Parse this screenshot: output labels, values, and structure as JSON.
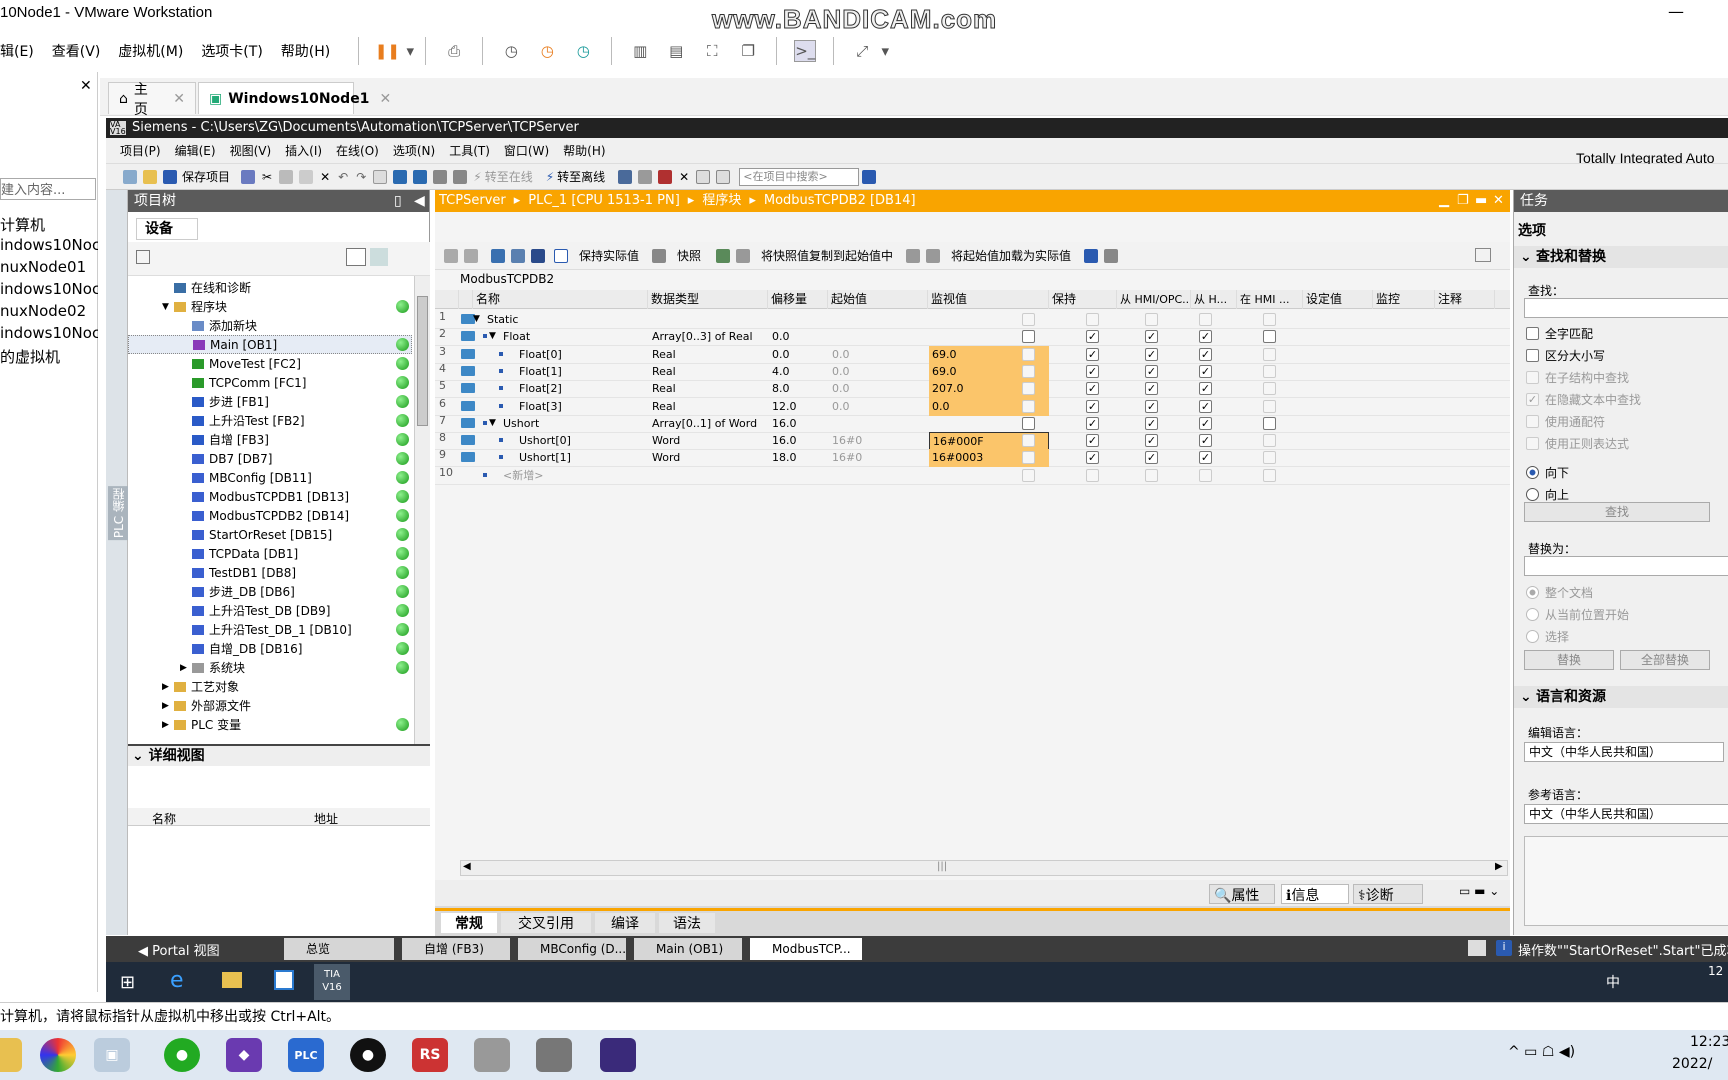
{
  "vm": {
    "title": "10Node1 - VMware Workstation",
    "watermark": "www.BANDICAM.com",
    "menu": [
      "辑(E)",
      "查看(V)",
      "虚拟机(M)",
      "选项卡(T)",
      "帮助(H)"
    ],
    "library": {
      "search_placeholder": "建入内容...",
      "items": [
        "计算机",
        "indows10Noc",
        "nuxNode01",
        "indows10Noc",
        "nuxNode02",
        "indows10Noc",
        "的虚拟机"
      ]
    },
    "tabs": [
      {
        "label": "主页"
      },
      {
        "label": "Windows10Node1"
      }
    ],
    "status": "计算机，请将鼠标指针从虚拟机中移出或按 Ctrl+Alt。"
  },
  "tia": {
    "title": "Siemens  -  C:\\Users\\ZG\\Documents\\Automation\\TCPServer\\TCPServer",
    "title_logo": "VA V16",
    "brand": "Totally Integrated Auto",
    "menu": [
      "项目(P)",
      "编辑(E)",
      "视图(V)",
      "插入(I)",
      "在线(O)",
      "选项(N)",
      "工具(T)",
      "窗口(W)",
      "帮助(H)"
    ],
    "toolbar": {
      "save": "保存项目",
      "go_online": "转至在线",
      "go_offline": "转至离线",
      "search_placeholder": "<在项目中搜索>"
    },
    "project_tree": {
      "title": "项目树",
      "tab": "设备",
      "side_label": "PLC 编程",
      "items": [
        {
          "label": "在线和诊断",
          "indent": 1,
          "color": "#3a6ea5",
          "status": false,
          "expander": ""
        },
        {
          "label": "程序块",
          "indent": 1,
          "color": "#e0b040",
          "status": true,
          "expander": "▼"
        },
        {
          "label": "添加新块",
          "indent": 2,
          "color": "#6a8cc7",
          "status": false,
          "expander": ""
        },
        {
          "label": "Main [OB1]",
          "indent": 2,
          "color": "#8a3ab9",
          "status": true,
          "expander": "",
          "selected": true
        },
        {
          "label": "MoveTest [FC2]",
          "indent": 2,
          "color": "#2a9a2a",
          "status": true,
          "expander": ""
        },
        {
          "label": "TCPComm [FC1]",
          "indent": 2,
          "color": "#2a9a2a",
          "status": true,
          "expander": ""
        },
        {
          "label": "步进 [FB1]",
          "indent": 2,
          "color": "#2a5ac7",
          "status": true,
          "expander": ""
        },
        {
          "label": "上升沿Test [FB2]",
          "indent": 2,
          "color": "#2a5ac7",
          "status": true,
          "expander": ""
        },
        {
          "label": "自增 [FB3]",
          "indent": 2,
          "color": "#2a5ac7",
          "status": true,
          "expander": ""
        },
        {
          "label": "DB7 [DB7]",
          "indent": 2,
          "color": "#3a5fd0",
          "status": true,
          "expander": ""
        },
        {
          "label": "MBConfig [DB11]",
          "indent": 2,
          "color": "#3a5fd0",
          "status": true,
          "expander": ""
        },
        {
          "label": "ModbusTCPDB1 [DB13]",
          "indent": 2,
          "color": "#3a5fd0",
          "status": true,
          "expander": ""
        },
        {
          "label": "ModbusTCPDB2 [DB14]",
          "indent": 2,
          "color": "#3a5fd0",
          "status": true,
          "expander": ""
        },
        {
          "label": "StartOrReset [DB15]",
          "indent": 2,
          "color": "#3a5fd0",
          "status": true,
          "expander": ""
        },
        {
          "label": "TCPData [DB1]",
          "indent": 2,
          "color": "#3a5fd0",
          "status": true,
          "expander": ""
        },
        {
          "label": "TestDB1 [DB8]",
          "indent": 2,
          "color": "#3a5fd0",
          "status": true,
          "expander": ""
        },
        {
          "label": "步进_DB [DB6]",
          "indent": 2,
          "color": "#3a5fd0",
          "status": true,
          "expander": ""
        },
        {
          "label": "上升沿Test_DB [DB9]",
          "indent": 2,
          "color": "#3a5fd0",
          "status": true,
          "expander": ""
        },
        {
          "label": "上升沿Test_DB_1 [DB10]",
          "indent": 2,
          "color": "#3a5fd0",
          "status": true,
          "expander": ""
        },
        {
          "label": "自增_DB [DB16]",
          "indent": 2,
          "color": "#3a5fd0",
          "status": true,
          "expander": ""
        },
        {
          "label": "系统块",
          "indent": 2,
          "color": "#999",
          "status": true,
          "expander": "▶"
        },
        {
          "label": "工艺对象",
          "indent": 1,
          "color": "#e0b040",
          "status": false,
          "expander": "▶"
        },
        {
          "label": "外部源文件",
          "indent": 1,
          "color": "#e0b040",
          "status": false,
          "expander": "▶"
        },
        {
          "label": "PLC 变量",
          "indent": 1,
          "color": "#e0b040",
          "status": true,
          "expander": "▶"
        }
      ]
    },
    "detail_view": {
      "title": "详细视图",
      "col_name": "名称",
      "col_address": "地址"
    },
    "breadcrumb": [
      "TCPServer",
      "PLC_1 [CPU 1513-1 PN]",
      "程序块",
      "ModbusTCPDB2 [DB14]"
    ],
    "editor_toolbar": {
      "keep_actual": "保持实际值",
      "snapshot": "快照",
      "copy_snapshot": "将快照值复制到起始值中",
      "load_start": "将起始值加载为实际值"
    },
    "db_name": "ModbusTCPDB2",
    "columns": [
      "名称",
      "数据类型",
      "偏移量",
      "起始值",
      "监视值",
      "保持",
      "从 HMI/OPC...",
      "从 H...",
      "在 HMI ...",
      "设定值",
      "监控",
      "注释"
    ],
    "rows": [
      {
        "n": "1",
        "level": 0,
        "exp": "▼",
        "name": "Static",
        "type": "",
        "off": "",
        "start": "",
        "mon": "",
        "chk": [
          0,
          0,
          0,
          0
        ],
        "dis": true
      },
      {
        "n": "2",
        "level": 1,
        "exp": "▼",
        "name": "Float",
        "type": "Array[0..3] of Real",
        "off": "0.0",
        "start": "",
        "mon": "",
        "chk": [
          0,
          1,
          1,
          1
        ],
        "dis": false
      },
      {
        "n": "3",
        "level": 2,
        "exp": "",
        "name": "Float[0]",
        "type": "Real",
        "off": "0.0",
        "start": "0.0",
        "mon": "69.0",
        "chk": [
          0,
          1,
          1,
          1
        ],
        "dis": true
      },
      {
        "n": "4",
        "level": 2,
        "exp": "",
        "name": "Float[1]",
        "type": "Real",
        "off": "4.0",
        "start": "0.0",
        "mon": "69.0",
        "chk": [
          0,
          1,
          1,
          1
        ],
        "dis": true
      },
      {
        "n": "5",
        "level": 2,
        "exp": "",
        "name": "Float[2]",
        "type": "Real",
        "off": "8.0",
        "start": "0.0",
        "mon": "207.0",
        "chk": [
          0,
          1,
          1,
          1
        ],
        "dis": true
      },
      {
        "n": "6",
        "level": 2,
        "exp": "",
        "name": "Float[3]",
        "type": "Real",
        "off": "12.0",
        "start": "0.0",
        "mon": "0.0",
        "chk": [
          0,
          1,
          1,
          1
        ],
        "dis": true
      },
      {
        "n": "7",
        "level": 1,
        "exp": "▼",
        "name": "Ushort",
        "type": "Array[0..1] of Word",
        "off": "16.0",
        "start": "",
        "mon": "",
        "chk": [
          0,
          1,
          1,
          1
        ],
        "dis": false
      },
      {
        "n": "8",
        "level": 2,
        "exp": "",
        "name": "Ushort[0]",
        "type": "Word",
        "off": "16.0",
        "start": "16#0",
        "mon": "16#000F",
        "chk": [
          0,
          1,
          1,
          1
        ],
        "dis": true
      },
      {
        "n": "9",
        "level": 2,
        "exp": "",
        "name": "Ushort[1]",
        "type": "Word",
        "off": "18.0",
        "start": "16#0",
        "mon": "16#0003",
        "chk": [
          0,
          1,
          1,
          1
        ],
        "dis": true
      },
      {
        "n": "10",
        "level": 1,
        "exp": "",
        "name": "<新增>",
        "type": "",
        "off": "",
        "start": "",
        "mon": "",
        "chk": [
          0,
          0,
          0,
          0
        ],
        "dis": true
      }
    ],
    "inspector_tabs": {
      "properties": "属性",
      "info": "信息",
      "diagnostics": "诊断"
    },
    "bottom_tabs": [
      "常规",
      "交叉引用",
      "编译",
      "语法"
    ],
    "tasks": {
      "title": "任务",
      "options": "选项",
      "find_replace": "查找和替换",
      "find": "查找：",
      "whole_word": "全字匹配",
      "match_case": "区分大小写",
      "in_substructures": "在子结构中查找",
      "in_hidden": "在隐藏文本中查找",
      "wildcards": "使用通配符",
      "regex": "使用正则表达式",
      "down": "向下",
      "up": "向上",
      "find_btn": "查找",
      "replace_with": "替换为：",
      "whole_doc": "整个文档",
      "from_cursor": "从当前位置开始",
      "selection": "选择",
      "replace_btn": "替换",
      "replace_all_btn": "全部替换",
      "lang_res": "语言和资源",
      "edit_lang": "编辑语言：",
      "edit_lang_val": "中文（中华人民共和国）",
      "ref_lang": "参考语言：",
      "ref_lang_val": "中文（中华人民共和国）"
    },
    "portal": {
      "view": "Portal 视图",
      "tabs": [
        "总览",
        "自增 (FB3)",
        "MBConfig (D...",
        "Main (OB1)",
        "ModbusTCP..."
      ],
      "status": "操作数\"\"StartOrReset\".Start\"已成功修..."
    }
  },
  "vm_taskbar": {
    "ime": "中",
    "clock": "12"
  },
  "host_taskbar": {
    "clock_time": "12:23",
    "clock_date": "2022/"
  }
}
